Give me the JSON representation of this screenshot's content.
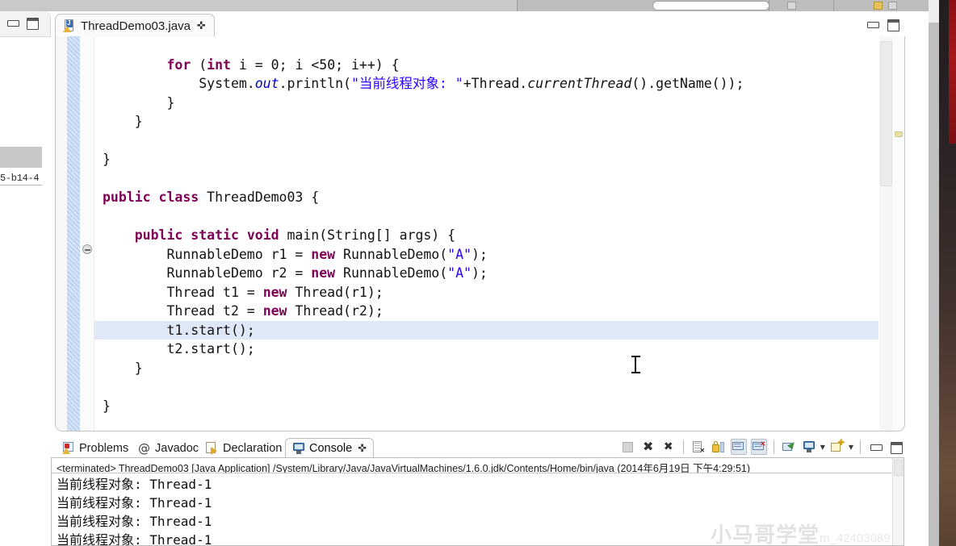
{
  "window": {
    "minimize_label": "Minimize",
    "maximize_label": "Maximize",
    "left_fragment_text": "5-b14-4"
  },
  "editor": {
    "tab": {
      "label": "ThreadDemo03.java",
      "close_glyph": "✜",
      "icon": "java-file-icon"
    },
    "code_lines": [
      {
        "id": "l1",
        "indent": 0,
        "highlight": false,
        "tokens": []
      },
      {
        "id": "l2",
        "indent": 0,
        "highlight": false,
        "tokens": [
          {
            "t": "        ",
            "c": "plain"
          },
          {
            "t": "for",
            "c": "kw"
          },
          {
            "t": " (",
            "c": "plain"
          },
          {
            "t": "int",
            "c": "kw"
          },
          {
            "t": " i = 0; i <50; i++) {",
            "c": "plain"
          }
        ]
      },
      {
        "id": "l3",
        "indent": 0,
        "highlight": false,
        "tokens": [
          {
            "t": "            System.",
            "c": "plain"
          },
          {
            "t": "out",
            "c": "fld"
          },
          {
            "t": ".println(",
            "c": "plain"
          },
          {
            "t": "\"当前线程对象: \"",
            "c": "str"
          },
          {
            "t": "+Thread.",
            "c": "plain"
          },
          {
            "t": "currentThread",
            "c": "mth"
          },
          {
            "t": "().getName());",
            "c": "plain"
          }
        ]
      },
      {
        "id": "l4",
        "indent": 0,
        "highlight": false,
        "tokens": [
          {
            "t": "        }",
            "c": "plain"
          }
        ]
      },
      {
        "id": "l5",
        "indent": 0,
        "highlight": false,
        "tokens": [
          {
            "t": "    }",
            "c": "plain"
          }
        ]
      },
      {
        "id": "l6",
        "indent": 0,
        "highlight": false,
        "tokens": []
      },
      {
        "id": "l7",
        "indent": 0,
        "highlight": false,
        "tokens": [
          {
            "t": "}",
            "c": "plain"
          }
        ]
      },
      {
        "id": "l8",
        "indent": 0,
        "highlight": false,
        "tokens": []
      },
      {
        "id": "l9",
        "indent": 0,
        "highlight": false,
        "tokens": [
          {
            "t": "public class",
            "c": "kw"
          },
          {
            "t": " ThreadDemo03 {",
            "c": "plain"
          }
        ]
      },
      {
        "id": "l10",
        "indent": 0,
        "highlight": false,
        "tokens": []
      },
      {
        "id": "l11",
        "indent": 0,
        "highlight": false,
        "tokens": [
          {
            "t": "    ",
            "c": "plain"
          },
          {
            "t": "public static void",
            "c": "kw"
          },
          {
            "t": " main(String[] args) {",
            "c": "plain"
          }
        ]
      },
      {
        "id": "l12",
        "indent": 0,
        "highlight": false,
        "tokens": [
          {
            "t": "        RunnableDemo r1 = ",
            "c": "plain"
          },
          {
            "t": "new",
            "c": "kw"
          },
          {
            "t": " RunnableDemo(",
            "c": "plain"
          },
          {
            "t": "\"A\"",
            "c": "str"
          },
          {
            "t": ");",
            "c": "plain"
          }
        ]
      },
      {
        "id": "l13",
        "indent": 0,
        "highlight": false,
        "tokens": [
          {
            "t": "        RunnableDemo r2 = ",
            "c": "plain"
          },
          {
            "t": "new",
            "c": "kw"
          },
          {
            "t": " RunnableDemo(",
            "c": "plain"
          },
          {
            "t": "\"A\"",
            "c": "str"
          },
          {
            "t": ");",
            "c": "plain"
          }
        ]
      },
      {
        "id": "l14",
        "indent": 0,
        "highlight": false,
        "tokens": [
          {
            "t": "        Thread t1 = ",
            "c": "plain"
          },
          {
            "t": "new",
            "c": "kw"
          },
          {
            "t": " Thread(r1);",
            "c": "plain"
          }
        ]
      },
      {
        "id": "l15",
        "indent": 0,
        "highlight": false,
        "tokens": [
          {
            "t": "        Thread t2 = ",
            "c": "plain"
          },
          {
            "t": "new",
            "c": "kw"
          },
          {
            "t": " Thread(r2);",
            "c": "plain"
          }
        ]
      },
      {
        "id": "l16",
        "indent": 0,
        "highlight": true,
        "tokens": [
          {
            "t": "        t1.start();",
            "c": "plain"
          }
        ]
      },
      {
        "id": "l17",
        "indent": 0,
        "highlight": false,
        "tokens": [
          {
            "t": "        t2.start();",
            "c": "plain"
          }
        ]
      },
      {
        "id": "l18",
        "indent": 0,
        "highlight": false,
        "tokens": [
          {
            "t": "    }",
            "c": "plain"
          }
        ]
      },
      {
        "id": "l19",
        "indent": 0,
        "highlight": false,
        "tokens": []
      },
      {
        "id": "l20",
        "indent": 0,
        "highlight": false,
        "tokens": [
          {
            "t": "}",
            "c": "plain"
          }
        ]
      }
    ]
  },
  "bottom_panel": {
    "tabs": [
      {
        "label": "Problems",
        "icon": "problems-icon",
        "active": false
      },
      {
        "label": "Javadoc",
        "icon": "javadoc-icon",
        "active": false
      },
      {
        "label": "Declaration",
        "icon": "declaration-icon",
        "active": false
      },
      {
        "label": "Console",
        "icon": "console-icon",
        "active": true
      }
    ],
    "tab_close_glyph": "✜",
    "toolbar": [
      {
        "name": "terminate-button",
        "title": "Terminate"
      },
      {
        "name": "remove-launch-button",
        "title": "Remove Launch"
      },
      {
        "name": "remove-all-terminated-button",
        "title": "Remove All Terminated Launches"
      },
      {
        "name": "clear-console-button",
        "title": "Clear Console"
      },
      {
        "name": "scroll-lock-button",
        "title": "Scroll Lock"
      },
      {
        "name": "show-console-on-output-button",
        "title": "Show Console When Standard Out Changes"
      },
      {
        "name": "show-console-on-error-button",
        "title": "Show Console When Standard Error Changes"
      },
      {
        "name": "pin-console-button",
        "title": "Pin Console"
      },
      {
        "name": "display-selected-console-button",
        "title": "Display Selected Console"
      },
      {
        "name": "open-console-button",
        "title": "Open Console"
      },
      {
        "name": "minimize-button",
        "title": "Minimize"
      },
      {
        "name": "maximize-button",
        "title": "Maximize"
      }
    ],
    "console": {
      "header": "<terminated> ThreadDemo03 [Java Application] /System/Library/Java/JavaVirtualMachines/1.6.0.jdk/Contents/Home/bin/java (2014年6月19日 下午4:29:51)",
      "lines": [
        "当前线程对象: Thread-1",
        "当前线程对象: Thread-1",
        "当前线程对象: Thread-1",
        "当前线程对象: Thread-1"
      ]
    }
  },
  "watermark": {
    "main": "小马哥学堂",
    "sub": "m_42403089"
  },
  "colors": {
    "keyword": "#7f0055",
    "string": "#2a00ff",
    "field": "#0000c0",
    "current_line_highlight": "#dfe8f6",
    "panel_bg": "#f3f3f3"
  }
}
